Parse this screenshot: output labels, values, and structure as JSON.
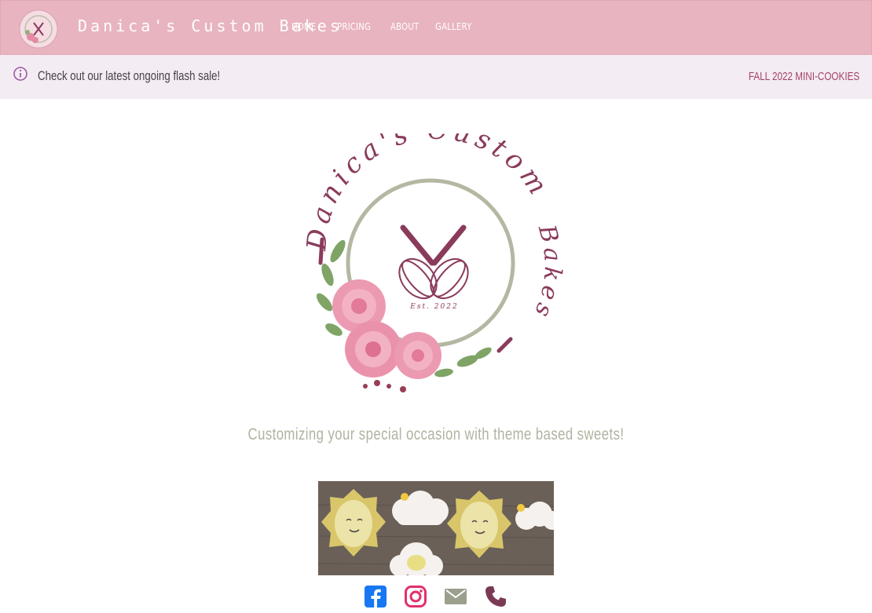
{
  "header": {
    "brand_name": "Danica's Custom Bakes",
    "nav": [
      {
        "label": "HOME"
      },
      {
        "label": "PRICING"
      },
      {
        "label": "ABOUT"
      },
      {
        "label": "GALLERY"
      }
    ]
  },
  "alert": {
    "message": "Check out our latest ongoing flash sale!",
    "link_label": "FALL 2022 MINI-COOKIES",
    "icon": "info-icon"
  },
  "hero": {
    "logo_text_top": "Danica's Custom",
    "logo_text_right": "Bakes",
    "established": "Est. 2022",
    "tagline": "Customizing your special occasion with theme based sweets!"
  },
  "footer": {
    "icons": [
      "facebook-icon",
      "instagram-icon",
      "email-icon",
      "phone-icon"
    ]
  },
  "colors": {
    "header_bg": "#e8b4bf",
    "alert_bg": "#f4ecf3",
    "accent": "#a1446a",
    "sage": "#aeb49f",
    "facebook": "#1877f2",
    "instagram": "#e1306c",
    "email": "#9aa08c",
    "phone": "#7a3a55"
  }
}
